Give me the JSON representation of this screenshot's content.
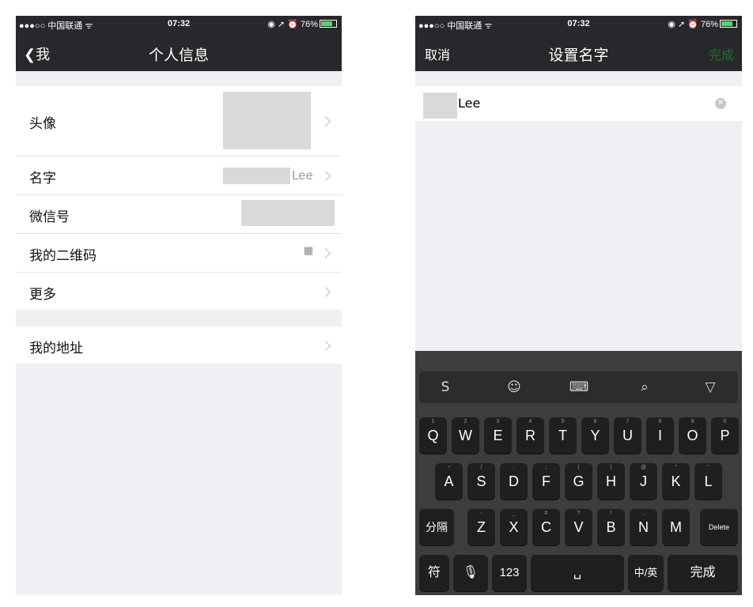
{
  "left_screen": {
    "status": {
      "carrier": "●●●○○ 中国联通 ᯤ",
      "time": "07:32",
      "indicators": "◉ ➚ ⏰ 76%"
    },
    "nav": {
      "back_label": "❮我",
      "title": "个人信息"
    },
    "rows": [
      {
        "label": "头像"
      },
      {
        "label": "名字",
        "value": "Lee"
      },
      {
        "label": "微信号"
      },
      {
        "label": "我的二维码",
        "qr_glyph": "▦"
      },
      {
        "label": "更多"
      }
    ],
    "address_row": {
      "label": "我的地址"
    }
  },
  "right_screen": {
    "status": {
      "carrier": "●●●○○ 中国联通 ᯤ",
      "time": "07:32",
      "indicators": "◉ ➚ ⏰ 76%"
    },
    "nav": {
      "cancel_label": "取消",
      "title": "设置名字",
      "done_label": "完成"
    },
    "input": {
      "value": "Lee",
      "clear_glyph": "✕"
    },
    "keyboard": {
      "toolbar": [
        "S",
        "☺",
        "⌨",
        "⌕",
        "▽"
      ],
      "row1": [
        [
          "Q",
          "1"
        ],
        [
          "W",
          "2"
        ],
        [
          "E",
          "3"
        ],
        [
          "R",
          "4"
        ],
        [
          "T",
          "5"
        ],
        [
          "Y",
          "6"
        ],
        [
          "U",
          "7"
        ],
        [
          "I",
          "8"
        ],
        [
          "O",
          "9"
        ],
        [
          "P",
          "0"
        ]
      ],
      "row2": [
        [
          "A",
          "~"
        ],
        [
          "S",
          "/"
        ],
        [
          "D",
          ":"
        ],
        [
          "F",
          ";"
        ],
        [
          "G",
          "("
        ],
        [
          "H",
          ")"
        ],
        [
          "J",
          "@"
        ],
        [
          "K",
          "\""
        ],
        [
          "L",
          "“"
        ]
      ],
      "row3": [
        [
          "Z",
          "-"
        ],
        [
          "X",
          "_"
        ],
        [
          "C",
          "#"
        ],
        [
          "V",
          "?"
        ],
        [
          "B",
          "!"
        ],
        [
          "N",
          ","
        ],
        [
          "M",
          "."
        ]
      ],
      "fenge": "分隔",
      "delete": "Delete",
      "fu": "符",
      "mic": "🎙",
      "num": "123",
      "space": "␣",
      "zhongying": "中/英",
      "done": "完成"
    }
  }
}
